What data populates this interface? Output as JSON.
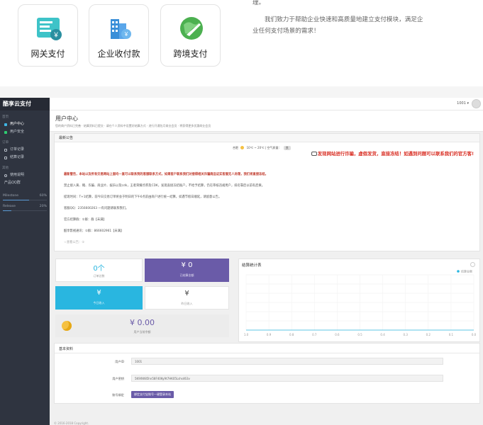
{
  "promo": {
    "cards": [
      {
        "label": "网关支付",
        "icon": "gateway-payment-icon"
      },
      {
        "label": "企业收付款",
        "icon": "enterprise-payment-icon"
      },
      {
        "label": "跨境支付",
        "icon": "cross-border-payment-icon"
      }
    ],
    "text_line1": "理。",
    "text_line2": "我们致力于帮助企业快速和高质量地建立支付模块，满足企",
    "text_line3": "业任何支付场景的需求！"
  },
  "sidebar": {
    "brand": "酷享云支付",
    "section_home": "首页",
    "nav_home": [
      {
        "label": "用户中心",
        "active": true,
        "color": "#3fb6e5"
      },
      {
        "label": "用户安全",
        "active": false,
        "color": "#2ecc71"
      }
    ],
    "section_orders": "订单",
    "nav_orders": [
      {
        "label": "订单记录",
        "color": "#b8bec8"
      },
      {
        "label": "结算记录",
        "color": "#b8bec8"
      }
    ],
    "section_other": "其他",
    "nav_other": [
      {
        "label": "使用说明",
        "color": "#b8bec8"
      },
      {
        "label": "产品QQ群",
        "color": "#b8bec8"
      }
    ],
    "progress": [
      {
        "label": "Milestone",
        "value": "60%",
        "fraction": 0.6
      },
      {
        "label": "Release",
        "value": "20%",
        "fraction": 0.2
      }
    ]
  },
  "topbar": {
    "user_id": "1001 ▾"
  },
  "header": {
    "title": "用户中心",
    "subtitle": "您的商户资料已完善 · 结算资料已提交 · 请在个人资料中设置好结算方式 · 进行开通包月商业会员 · 将获得更多优惠商业会员"
  },
  "notice": {
    "title": "最新公告",
    "weather_city": "合肥",
    "weather_temp": "10℃ ~ 20℃ | 空气质量：",
    "weather_quality": "良",
    "marquee": "发现网站进行诈骗，虚假发货，直接冻结！如遇到问题可以联系我们的官方客!",
    "lines": [
      "最新警告，本站以及所有交易网站上面均一直可以联系到的客服联系方式，如果客户联系我们对接得相关诈骗商品证实客服无人处理，我们将直接冻结。",
      "禁止接入黄、赌、诈骗、商业片、娱乐以及cdk，王者荣耀点券及CDK，发现直接冻结账户，不给予结算，仍在审核违规用户，排名靠后以前有后果。",
      "提现时间：T+1结算，前今日交易订单将会于明日的下午6点前由商户进行统一结算，如遇节假日顺延，请留意公告。",
      "客服QQ：2356600263 一有问题请联系我们。",
      "官方结算群：①群：群【未满】",
      "酷享影视通讯：①群：866602961【未满】",
      "☆查看公告：①"
    ]
  },
  "stats": {
    "today_orders_value": "0个",
    "today_orders_label": "订单总数",
    "today_income_value": "¥ 0",
    "today_income_label": "已结算金额",
    "yesterday_value": "¥",
    "yesterday_label": "今日收入",
    "pending_value": "¥",
    "pending_label": "昨日收入",
    "balance_value": "¥ 0.00",
    "balance_label": "用户当前余额"
  },
  "chart_data": {
    "type": "line",
    "title": "结算统计表",
    "legend": [
      "结算金额"
    ],
    "legend_placement": "top-right",
    "x": [
      "1.0",
      "0.9",
      "0.8",
      "0.7",
      "0.6",
      "0.5",
      "0.4",
      "0.3",
      "0.2",
      "0.1",
      "0.0"
    ],
    "series": [
      {
        "name": "结算金额",
        "values": [
          0,
          0,
          0,
          0,
          0,
          0,
          0,
          0,
          0,
          0,
          0
        ]
      }
    ],
    "grid": true
  },
  "profile": {
    "title": "基本资料",
    "uid_label": "用户ID",
    "uid_value": "1001",
    "key_label": "用户密钥",
    "key_value": "5K90W85hn58F40Ky9t7HK05Lshs463v",
    "bind_label": "账号绑定",
    "bind_button": "绑定支付宝账号一键登录本站"
  },
  "footer": "© 2016-2018 Copyright.",
  "colors": {
    "sidebar": "#2f3440",
    "accent_purple": "#6a5ba8",
    "accent_cyan": "#29b6e0",
    "warning_red": "#d93025"
  }
}
